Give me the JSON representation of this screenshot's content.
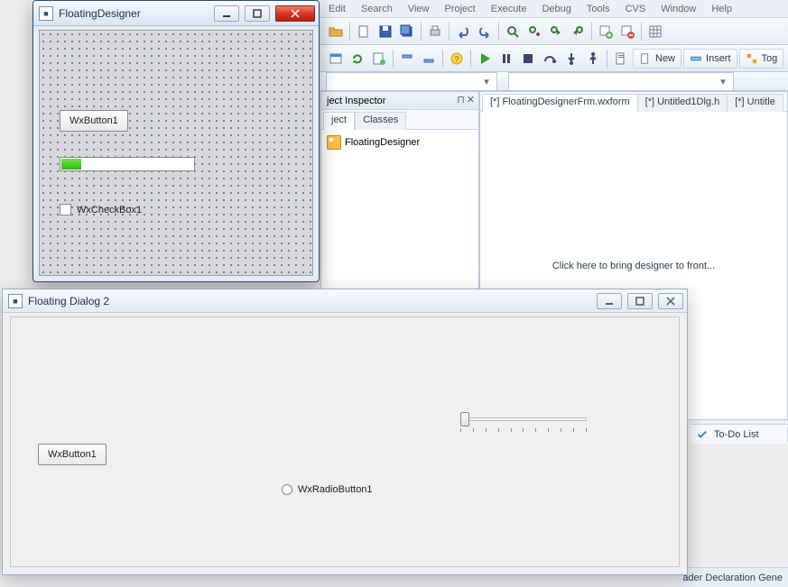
{
  "menubar": [
    "Edit",
    "Search",
    "View",
    "Project",
    "Execute",
    "Debug",
    "Tools",
    "CVS",
    "Window",
    "Help"
  ],
  "toolbar1_buttons": [
    "open-folder-icon",
    "sep",
    "new-file-icon",
    "save-icon",
    "save-all-icon",
    "sep",
    "print-icon",
    "sep",
    "undo-icon",
    "redo-icon",
    "sep",
    "find-icon",
    "replace-icon",
    "find-next-icon",
    "find-prev-icon",
    "sep",
    "add-item-icon",
    "remove-item-icon",
    "sep",
    "grid-icon"
  ],
  "toolbar2": {
    "left_buttons": [
      "class-browser-icon",
      "rebuild-icon",
      "new-class-icon",
      "sep",
      "goto-decl-icon",
      "goto-impl-icon",
      "sep",
      "help-icon",
      "sep"
    ],
    "run_buttons": [
      "run-icon",
      "pause-icon",
      "stop-icon",
      "step-over-icon",
      "step-into-icon",
      "step-out-icon",
      "sep",
      "compile-icon"
    ],
    "new_label": "New",
    "insert_label": "Insert",
    "toggle_label": "Tog"
  },
  "panels": {
    "inspector": {
      "title": "ject Inspector",
      "tabs": [
        "ject",
        "Classes"
      ],
      "tree": [
        {
          "label": "FloatingDesigner"
        }
      ]
    }
  },
  "editor": {
    "tabs": [
      "[*] FloatingDesignerFrm.wxform",
      "[*] Untitled1Dlg.h",
      "[*] Untitle"
    ],
    "message": "Click here to bring designer to front..."
  },
  "bottom": {
    "todo_label": "To-Do List"
  },
  "status": {
    "text": "ader Declaration Gene"
  },
  "win1": {
    "title": "FloatingDesigner",
    "button_label": "WxButton1",
    "checkbox_label": "WxCheckBox1"
  },
  "win2": {
    "title": "Floating Dialog 2",
    "button_label": "WxButton1",
    "radio_label": "WxRadioButton1"
  }
}
